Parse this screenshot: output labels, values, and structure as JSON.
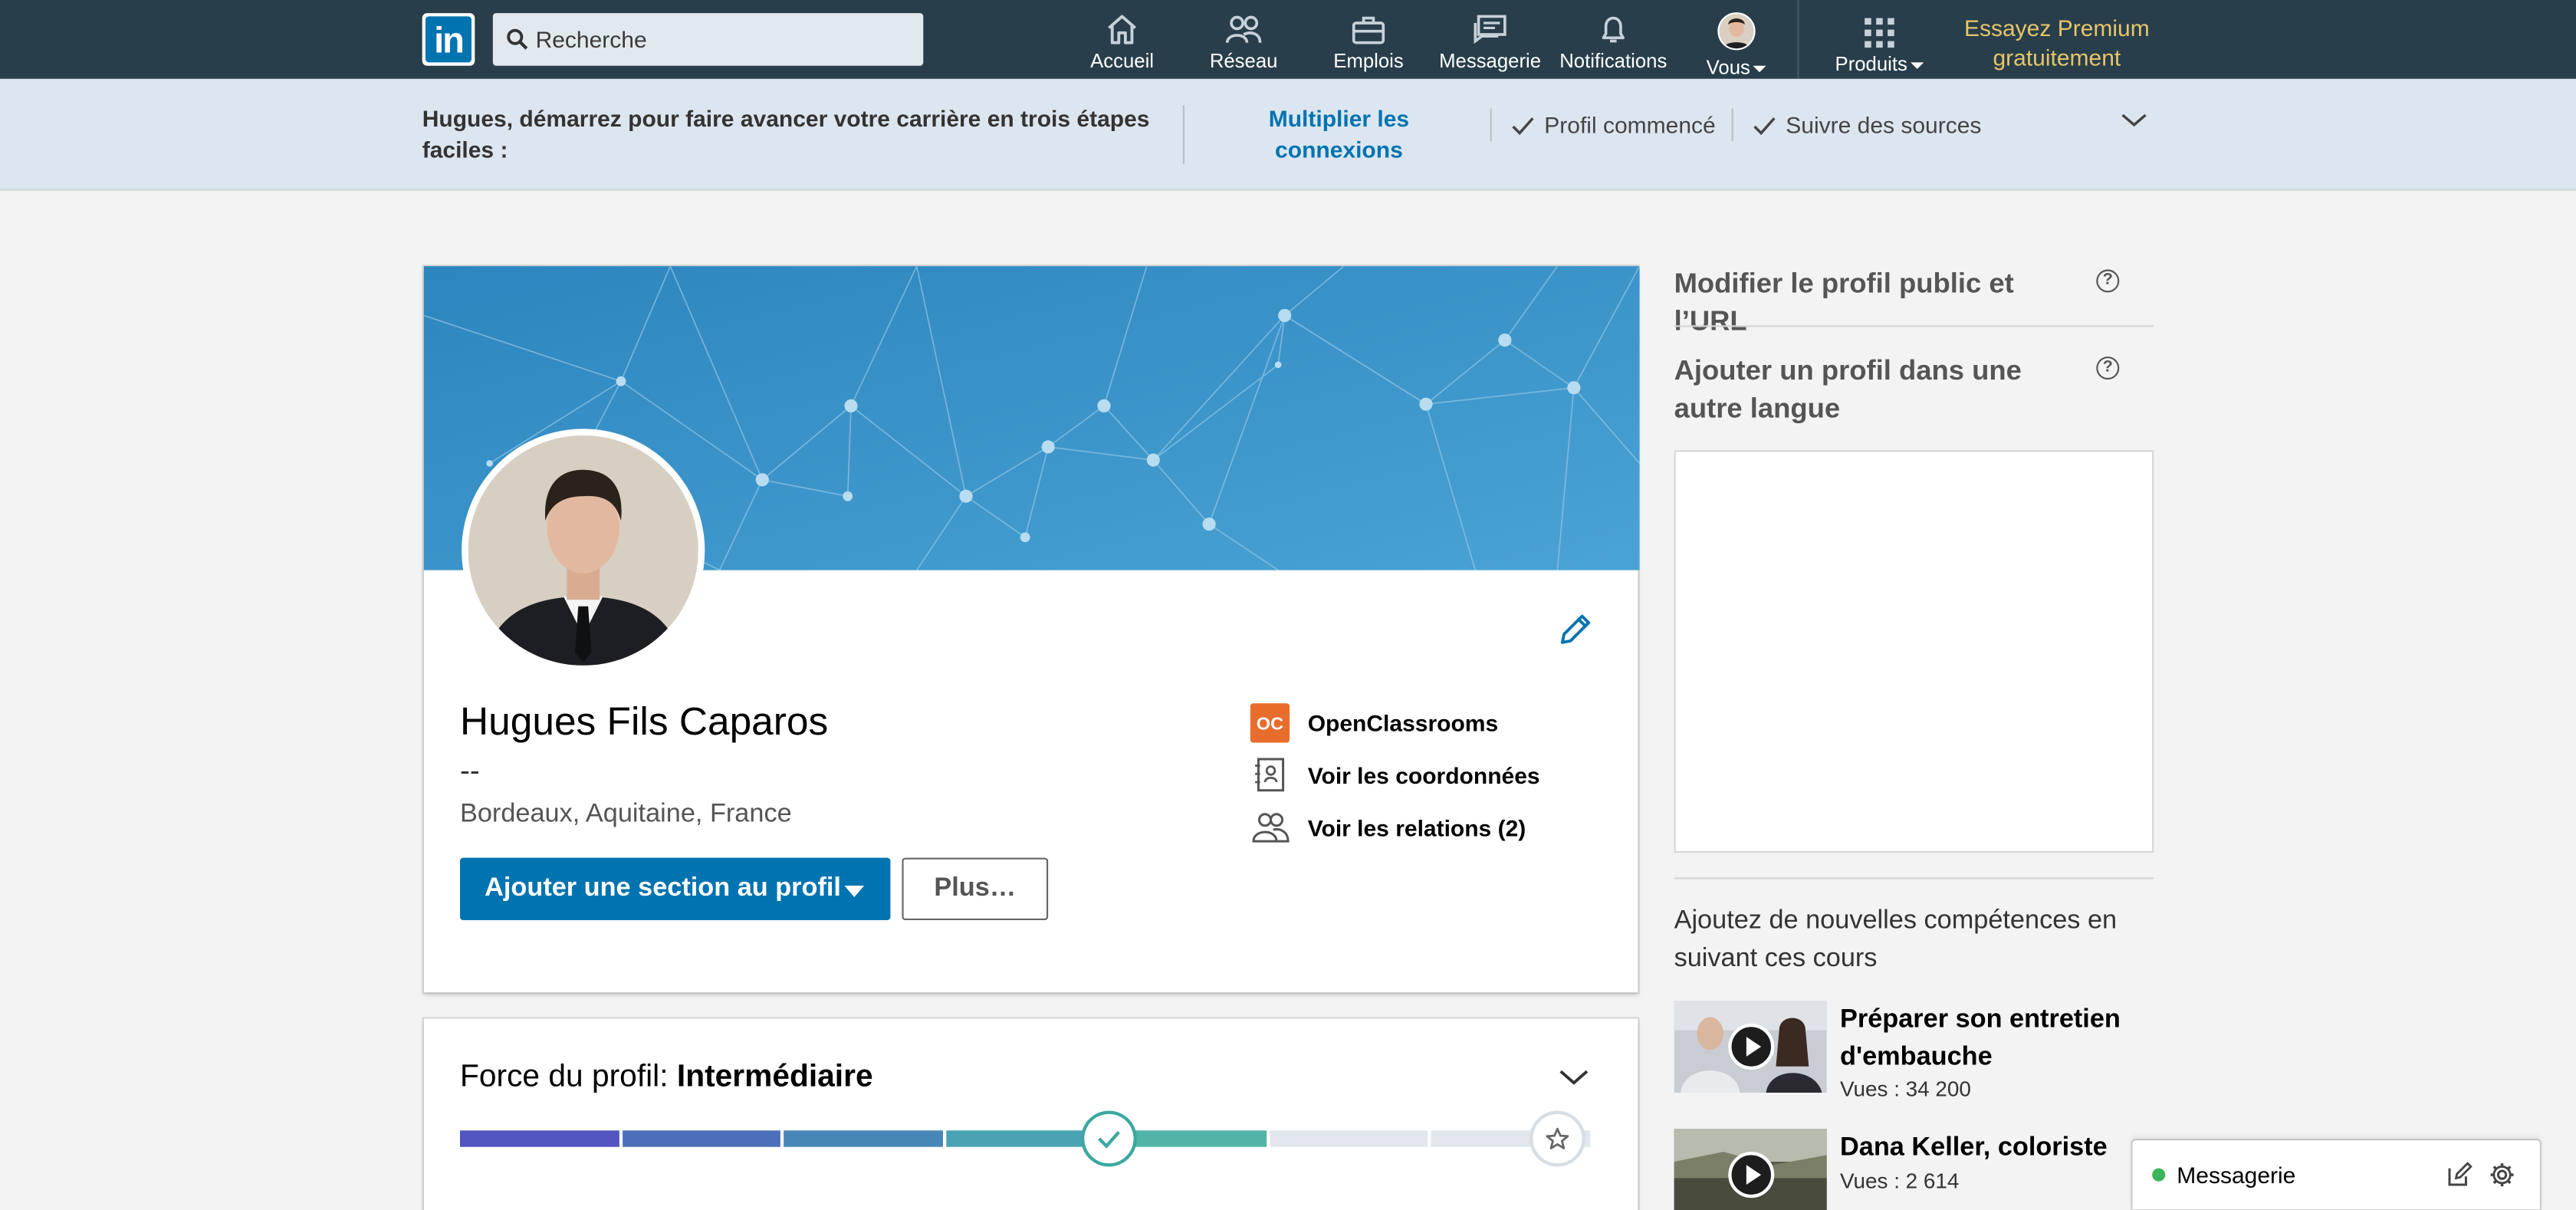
{
  "nav": {
    "logo": "in",
    "search_placeholder": "Recherche",
    "items": [
      {
        "label": "Accueil",
        "icon": "home-icon"
      },
      {
        "label": "Réseau",
        "icon": "network-icon"
      },
      {
        "label": "Emplois",
        "icon": "briefcase-icon"
      },
      {
        "label": "Messagerie",
        "icon": "messaging-icon"
      },
      {
        "label": "Notifications",
        "icon": "bell-icon"
      },
      {
        "label": "Vous",
        "icon": "avatar"
      },
      {
        "label": "Produits",
        "icon": "grid-icon"
      }
    ],
    "premium": "Essayez Premium gratuitement",
    "bg_color": "#283e4a",
    "premium_color": "#e7c56b"
  },
  "banner": {
    "message": "Hugues, démarrez pour faire avancer votre carrière en trois étapes faciles :",
    "cta": "Multiplier les connexions",
    "steps": [
      "Profil commencé",
      "Suivre des sources"
    ]
  },
  "profile": {
    "name": "Hugues Fils Caparos",
    "headline": "--",
    "location": "Bordeaux, Aquitaine, France",
    "add_section_button": "Ajouter une section au profil",
    "more_button": "Plus…",
    "links": [
      {
        "label": "OpenClassrooms",
        "icon": "openclassrooms-logo"
      },
      {
        "label": "Voir les coordonnées",
        "icon": "contact-card-icon"
      },
      {
        "label": "Voir les relations (2)",
        "icon": "people-icon"
      }
    ],
    "accent": "#0073b1"
  },
  "strength": {
    "label": "Force du profil:",
    "level": "Intermédiaire",
    "segments_total": 7,
    "segments_completed": 5
  },
  "sidebar": {
    "edit_public_profile": "Modifier le profil public et l’URL",
    "add_language_profile": "Ajouter un profil dans une autre langue",
    "courses_heading": "Ajoutez de nouvelles compétences en suivant ces cours",
    "courses": [
      {
        "title": "Préparer son entretien d'embauche",
        "views": "Vues : 34 200"
      },
      {
        "title": "Dana Keller, coloriste",
        "views": "Vues : 2 614"
      }
    ]
  },
  "messaging": {
    "label": "Messagerie"
  }
}
